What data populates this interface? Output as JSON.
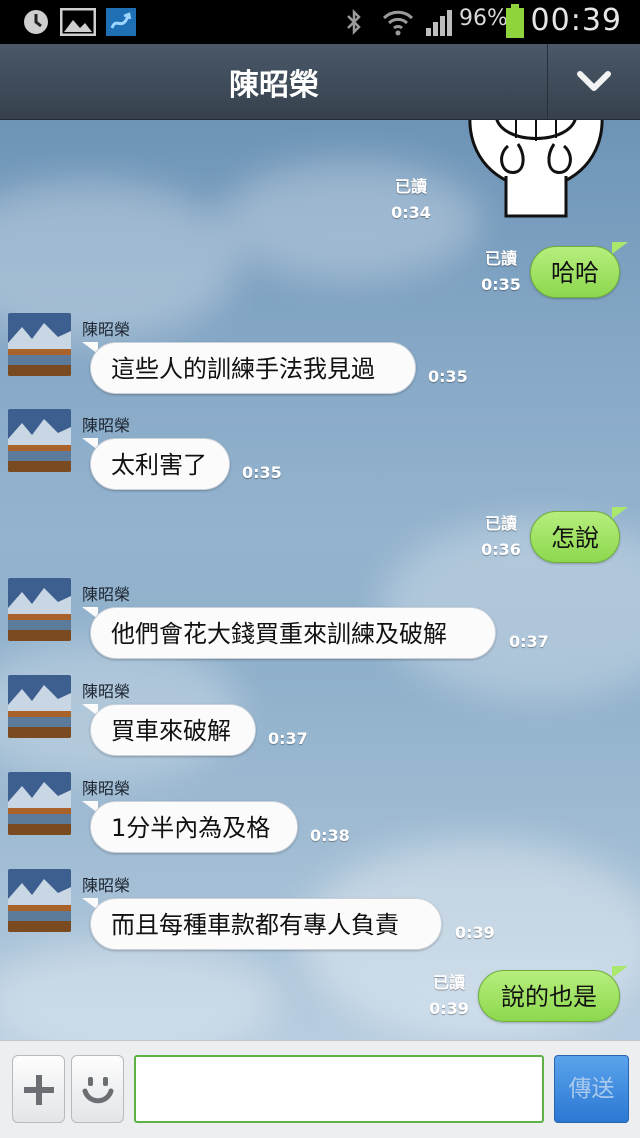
{
  "status_bar": {
    "battery_percent": "96%",
    "battery_level": 0.96,
    "time": "00:39",
    "icons": [
      "alarm-icon",
      "gallery-icon",
      "app-notification-icon",
      "bluetooth-icon",
      "wifi-icon",
      "signal-icon",
      "battery-icon"
    ]
  },
  "header": {
    "title": "陳昭榮",
    "dropdown_icon": "chevron-down-icon"
  },
  "chat": {
    "read_label": "已讀",
    "sticker": {
      "time": "0:34",
      "read": "已讀",
      "icon": "grinning-character-sticker"
    },
    "messages": [
      {
        "direction": "out",
        "text": "哈哈",
        "time": "0:35",
        "read": "已讀"
      },
      {
        "direction": "in",
        "sender": "陳昭榮",
        "text": "這些人的訓練手法我見過",
        "time": "0:35"
      },
      {
        "direction": "in",
        "sender": "陳昭榮",
        "text": "太利害了",
        "time": "0:35"
      },
      {
        "direction": "out",
        "text": "怎說",
        "time": "0:36",
        "read": "已讀"
      },
      {
        "direction": "in",
        "sender": "陳昭榮",
        "text": "他們會花大錢買重來訓練及破解",
        "time": "0:37"
      },
      {
        "direction": "in",
        "sender": "陳昭榮",
        "text": "買車來破解",
        "time": "0:37"
      },
      {
        "direction": "in",
        "sender": "陳昭榮",
        "text": "1分半內為及格",
        "time": "0:38"
      },
      {
        "direction": "in",
        "sender": "陳昭榮",
        "text": "而且每種車款都有專人負責",
        "time": "0:39"
      },
      {
        "direction": "out",
        "text": "說的也是",
        "time": "0:39",
        "read": "已讀"
      }
    ]
  },
  "input_bar": {
    "plus_icon": "plus-icon",
    "emoticon_icon": "smiley-icon",
    "text_value": "",
    "send_label": "傳送"
  },
  "colors": {
    "header": "#3f4b58",
    "outgoing_bubble": "#a4e46a",
    "incoming_bubble": "#fbfbfb",
    "send_button": "#3a8be0",
    "input_border": "#5eb245"
  }
}
